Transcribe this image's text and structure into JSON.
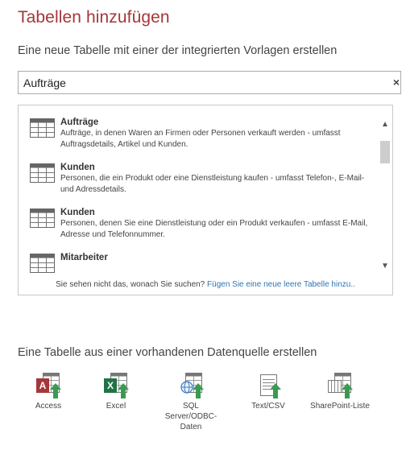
{
  "dialog": {
    "title": "Tabellen hinzufügen",
    "subtitle": "Eine neue Tabelle mit einer der integrierten Vorlagen erstellen"
  },
  "search": {
    "value": "Aufträge",
    "clear_label": "×"
  },
  "results": {
    "items": [
      {
        "name": "Aufträge",
        "description": "Aufträge, in denen Waren an Firmen oder Personen verkauft werden - umfasst Auftragsdetails, Artikel und Kunden.",
        "icon": "table-icon"
      },
      {
        "name": "Kunden",
        "description": "Personen, die ein Produkt oder eine Dienstleistung kaufen - umfasst Telefon-, E-Mail- und Adressdetails.",
        "icon": "table-icon"
      },
      {
        "name": "Kunden",
        "description": "Personen, denen Sie eine Dienstleistung oder ein Produkt verkaufen - umfasst E-Mail, Adresse und Telefonnummer.",
        "icon": "table-icon"
      },
      {
        "name": "Mitarbeiter",
        "description": "",
        "icon": "table-icon"
      }
    ],
    "footer_text": "Sie sehen nicht das, wonach Sie suchen?",
    "footer_link": "Fügen Sie eine neue leere Tabelle hinzu..",
    "scroll_up": "▲",
    "scroll_down": "▼"
  },
  "sources": {
    "title": "Eine Tabelle aus einer vorhandenen Datenquelle erstellen",
    "items": [
      {
        "label": "Access",
        "icon": "access-icon"
      },
      {
        "label": "Excel",
        "icon": "excel-icon"
      },
      {
        "label": "SQL Server/ODBC-Daten",
        "icon": "sql-server-icon"
      },
      {
        "label": "Text/CSV",
        "icon": "text-csv-icon"
      },
      {
        "label": "SharePoint-Liste",
        "icon": "sharepoint-list-icon"
      }
    ]
  },
  "colors": {
    "accent": "#a4373a",
    "link": "#2e75b6",
    "access_red": "#a4373a",
    "excel_green": "#217346",
    "arrow_green": "#3a9a52"
  }
}
